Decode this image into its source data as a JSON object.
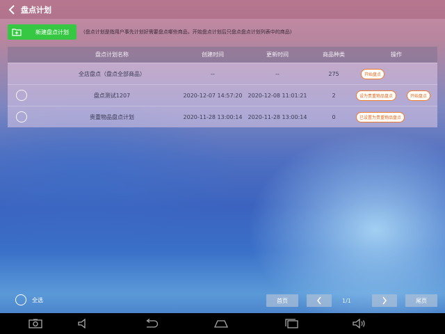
{
  "header": {
    "title": "盘点计划"
  },
  "toolbar": {
    "new_plan_label": "新建盘点计划",
    "description": "(盘点计划是指用户事先计划好需要盘点哪些商品，开始盘点计划后只盘点盘点计划列表中的商品)"
  },
  "table": {
    "columns": [
      "盘点计划名称",
      "创建时间",
      "更新时间",
      "商品种类",
      "操作"
    ],
    "rows": [
      {
        "name": "全店盘点（盘点全部商品）",
        "created": "--",
        "updated": "--",
        "count": "275",
        "ops": [
          "开始盘点"
        ]
      },
      {
        "name": "盘点测试1207",
        "created": "2020-12-07 14:57:20",
        "updated": "2020-12-08 11:01:21",
        "count": "2",
        "ops": [
          "设为贵重物品盘点",
          "开始盘点"
        ]
      },
      {
        "name": "贵重物品盘点计划",
        "created": "2020-11-28 13:00:14",
        "updated": "2020-11-28 13:00:14",
        "count": "0",
        "ops": [
          "已设置为贵重物品盘点"
        ]
      }
    ]
  },
  "footer": {
    "select_all": "全选",
    "first_page": "首页",
    "page_info": "1/1",
    "last_page": "尾页"
  },
  "colors": {
    "accent_green": "#37c843",
    "op_orange": "#f07a2a"
  }
}
